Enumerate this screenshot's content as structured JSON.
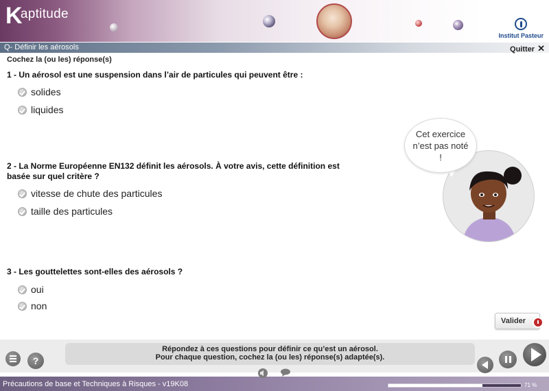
{
  "header": {
    "logo_k": "K",
    "logo_rest": "aptitude",
    "partner": "Institut Pasteur"
  },
  "titlebar": {
    "title": "Q- Définir les aérosols",
    "quit_label": "Quitter",
    "quit_icon": "✕"
  },
  "instruction": "Cochez la (ou les) réponse(s)",
  "questions": [
    {
      "text": "1 - Un aérosol est une suspension dans l’air de particules qui peuvent être :",
      "options": [
        "solides",
        "liquides"
      ]
    },
    {
      "text": "2 - La Norme Européenne EN132 définit les aérosols. À votre avis, cette définition est basée sur quel critère ?",
      "options": [
        "vitesse de chute des particules",
        "taille des particules"
      ]
    },
    {
      "text": "3 - Les gouttelettes sont-elles des aérosols ?",
      "options": [
        "oui",
        "non"
      ]
    }
  ],
  "bubble": "Cet exercice n’est pas noté !",
  "validate_label": "Valider",
  "message": {
    "line1": "Répondez à ces questions pour définir ce qu’est un aérosol.",
    "line2": "Pour chaque question, cochez la (ou les) réponse(s) adaptée(s)."
  },
  "help_label": "?",
  "footer": {
    "course": "Précautions de base et Techniques à Risques - v19K08",
    "progress_label": "71 %",
    "progress_value": 0.71
  },
  "colors": {
    "header_dark": "#6b3a63",
    "footer": "#8d7c9f",
    "validate_icon": "#c0282a",
    "partner_blue": "#1e4a8c"
  }
}
